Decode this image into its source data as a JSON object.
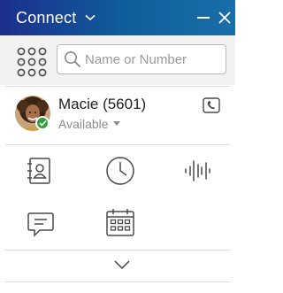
{
  "window": {
    "title": "Connect",
    "title_bar_color": "#1c2f8c"
  },
  "search": {
    "placeholder": "Name or Number",
    "value": ""
  },
  "profile": {
    "name": "Macie (5601)",
    "status": "Available",
    "presence_color": "#2e9e3e"
  },
  "icons": {
    "menu_chevron": "chevron-down-icon",
    "minimize": "minimize-icon",
    "close": "close-icon",
    "dialpad": "dialpad-icon",
    "search": "search-icon",
    "voicemail": "voicemail-icon",
    "contacts": "contacts-icon",
    "history": "clock-icon",
    "voice": "audio-wave-icon",
    "chat": "chat-icon",
    "calendar": "calendar-icon",
    "expand": "chevron-down-icon"
  }
}
